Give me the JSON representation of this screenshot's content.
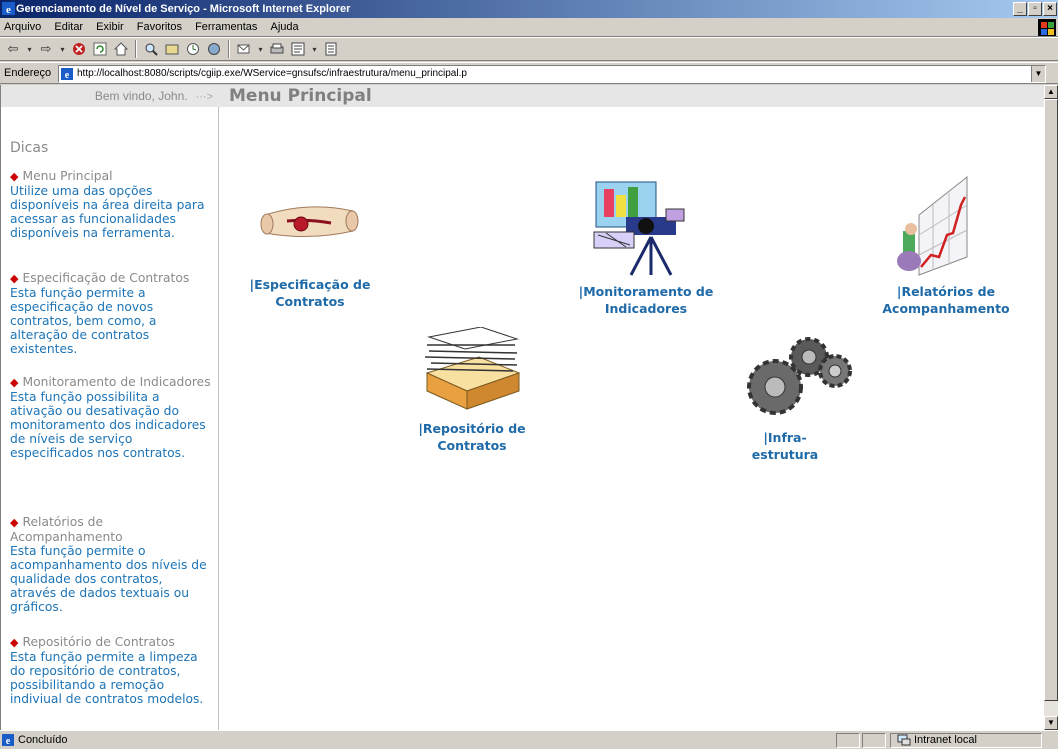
{
  "window": {
    "title": "Gerenciamento de Nível de Serviço - Microsoft Internet Explorer",
    "min_label": "_",
    "max_label": "▫",
    "close_label": "×"
  },
  "menubar": {
    "items": [
      "Arquivo",
      "Editar",
      "Exibir",
      "Favoritos",
      "Ferramentas",
      "Ajuda"
    ]
  },
  "address": {
    "label": "Endereço",
    "url": "http://localhost:8080/scripts/cgiip.exe/WService=gnsufsc/infraestrutura/menu_principal.p"
  },
  "page": {
    "welcome": "Bem vindo, John.",
    "welcome_arrow": "···>",
    "menu_title": "Menu Principal",
    "dicas_title": "Dicas"
  },
  "tips": [
    {
      "head": "Menu Principal",
      "body": "Utilize uma das opções disponíveis na área direita para acessar as funcionalidades disponíveis na ferramenta."
    },
    {
      "head": "Especificação de Contratos",
      "body": "Esta função permite a especificação de novos contratos, bem como, a alteração de contratos existentes."
    },
    {
      "head": "Monitoramento de Indicadores",
      "body": "Esta função possibilita a ativação ou desativação do monitoramento dos indicadores de níveis de serviço especificados nos contratos."
    },
    {
      "head": "Relatórios de Acompanhamento",
      "body": "Esta função permite o acompanhamento dos níveis de qualidade dos contratos, através de dados textuais ou gráficos."
    },
    {
      "head": "Repositório de Contratos",
      "body": "Esta função permite a limpeza do repositório de contratos, possibilitando a remoção indiviual de contratos modelos."
    }
  ],
  "menu_items": {
    "especificacao": {
      "line1": "|Especificação de",
      "line2": "Contratos"
    },
    "monitoramento": {
      "line1": "|Monitoramento de",
      "line2": "Indicadores"
    },
    "relatorios": {
      "line1": "|Relatórios de",
      "line2": "Acompanhamento"
    },
    "repositorio": {
      "line1": "|Repositório de",
      "line2": "Contratos"
    },
    "infra": {
      "line1": "|Infra-",
      "line2": "estrutura"
    }
  },
  "status": {
    "text": "Concluído",
    "zone": "Intranet local"
  },
  "icons": {
    "back": "back-arrow-icon",
    "forward": "forward-arrow-icon",
    "stop": "stop-icon",
    "refresh": "refresh-icon",
    "home": "home-icon",
    "search": "search-icon",
    "favorites": "favorites-icon",
    "history": "history-icon",
    "mail": "mail-icon",
    "print": "print-icon",
    "edit": "edit-icon",
    "discuss": "discuss-icon"
  },
  "colors": {
    "link": "#1f6aa8",
    "tip_body": "#1d74b6",
    "tip_head": "#8a8a8a",
    "diamond": "#cc0000",
    "titlebar_start": "#0a246a",
    "titlebar_end": "#a6caf0"
  }
}
